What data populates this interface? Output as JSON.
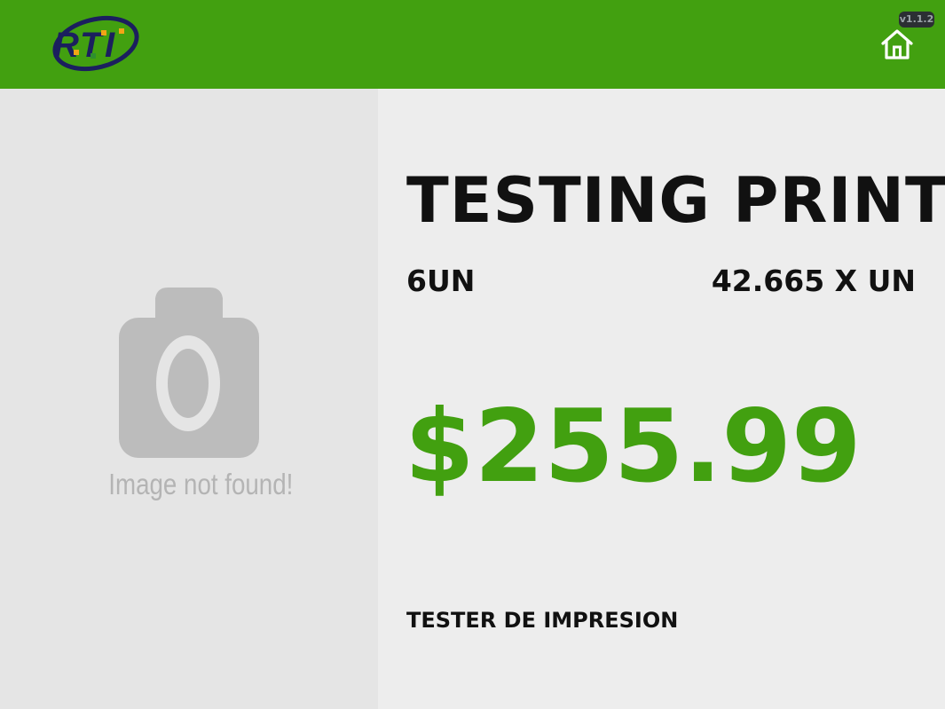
{
  "header": {
    "logo_text": "RTI",
    "version": "v1.1.2",
    "home_icon": "home-icon",
    "background_color": "#42a010"
  },
  "image_panel": {
    "placeholder_icon": "camera-icon",
    "placeholder_text": "Image not found!"
  },
  "product": {
    "title": "TESTING PRINT",
    "quantity": "6UN",
    "unit_price": "42.665 X UN",
    "price": "$255.99",
    "description": "TESTER DE IMPRESION",
    "price_color": "#42a010"
  }
}
